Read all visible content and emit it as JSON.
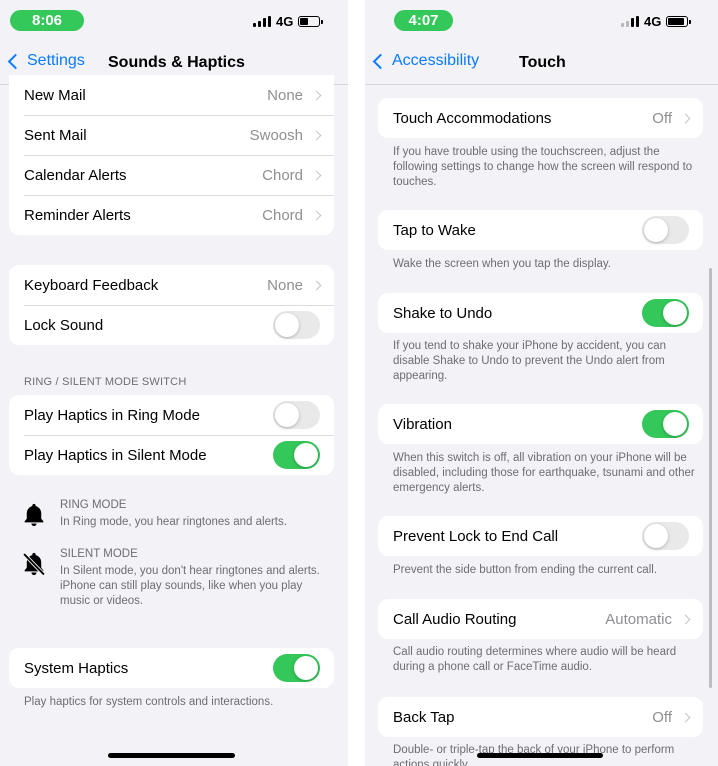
{
  "left": {
    "status": {
      "time": "8:06",
      "network": "4G",
      "battery_level": 0.45
    },
    "nav": {
      "back_label": "Settings",
      "title": "Sounds & Haptics"
    },
    "alerts": [
      {
        "label": "New Mail",
        "value": "None"
      },
      {
        "label": "Sent Mail",
        "value": "Swoosh"
      },
      {
        "label": "Calendar Alerts",
        "value": "Chord"
      },
      {
        "label": "Reminder Alerts",
        "value": "Chord"
      }
    ],
    "feedback": {
      "keyboard_label": "Keyboard Feedback",
      "keyboard_value": "None",
      "lock_sound_label": "Lock Sound",
      "lock_sound_on": false
    },
    "ring_section": {
      "header": "RING / SILENT MODE SWITCH",
      "ring_label": "Play Haptics in Ring Mode",
      "ring_on": false,
      "silent_label": "Play Haptics in Silent Mode",
      "silent_on": true
    },
    "ring_info": {
      "title": "RING MODE",
      "desc": "In Ring mode, you hear ringtones and alerts.",
      "icon": "bell-icon"
    },
    "silent_info": {
      "title": "SILENT MODE",
      "desc": "In Silent mode, you don't hear ringtones and alerts. iPhone can still play sounds, like when you play music or videos.",
      "icon": "bell-slash-icon"
    },
    "system_haptics": {
      "label": "System Haptics",
      "on": true,
      "footer": "Play haptics for system controls and interactions."
    }
  },
  "right": {
    "status": {
      "time": "4:07",
      "network": "4G",
      "battery_level": 0.85
    },
    "nav": {
      "back_label": "Accessibility",
      "title": "Touch"
    },
    "touch_accommodations": {
      "label": "Touch Accommodations",
      "value": "Off",
      "footer": "If you have trouble using the touchscreen, adjust the following settings to change how the screen will respond to touches."
    },
    "tap_to_wake": {
      "label": "Tap to Wake",
      "on": false,
      "footer": "Wake the screen when you tap the display."
    },
    "shake_to_undo": {
      "label": "Shake to Undo",
      "on": true,
      "footer": "If you tend to shake your iPhone by accident, you can disable Shake to Undo to prevent the Undo alert from appearing."
    },
    "vibration": {
      "label": "Vibration",
      "on": true,
      "footer": "When this switch is off, all vibration on your iPhone will be disabled, including those for earthquake, tsunami and other emergency alerts."
    },
    "prevent_lock": {
      "label": "Prevent Lock to End Call",
      "on": false,
      "footer": "Prevent the side button from ending the current call."
    },
    "call_audio": {
      "label": "Call Audio Routing",
      "value": "Automatic",
      "footer": "Call audio routing determines where audio will be heard during a phone call or FaceTime audio."
    },
    "back_tap": {
      "label": "Back Tap",
      "value": "Off",
      "footer": "Double- or triple-tap the back of your iPhone to perform actions quickly."
    }
  },
  "colors": {
    "accent": "#0a7aff",
    "toggle_on": "#34c759",
    "toggle_off": "#e9e9ea",
    "background": "#f2f2f7",
    "secondary_text": "#6d6d72"
  }
}
